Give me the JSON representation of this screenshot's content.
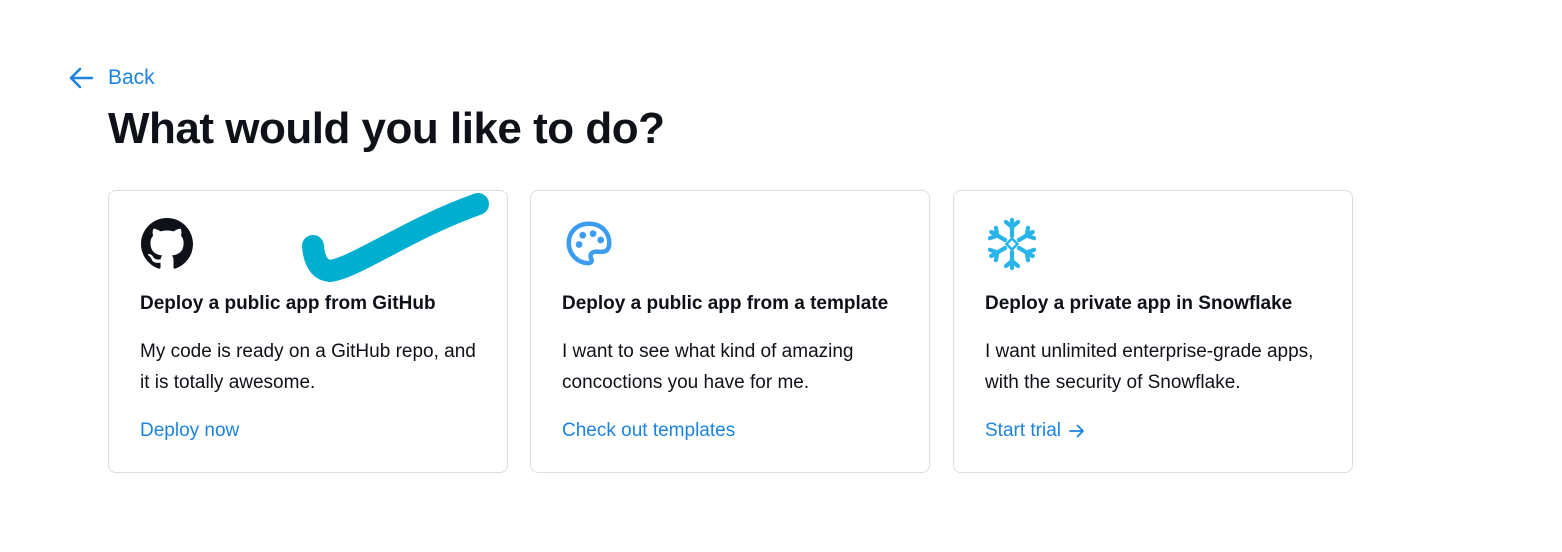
{
  "header": {
    "back_label": "Back",
    "title": "What would you like to do?"
  },
  "cards": [
    {
      "icon": "github-icon",
      "title": "Deploy a public app from GitHub",
      "description": "My code is ready on a GitHub repo, and it is totally awesome.",
      "link_label": "Deploy now"
    },
    {
      "icon": "palette-icon",
      "title": "Deploy a public app from a template",
      "description": "I want to see what kind of amazing concoctions you have for me.",
      "link_label": "Check out templates"
    },
    {
      "icon": "snowflake-icon",
      "title": "Deploy a private app in Snowflake",
      "description": "I want unlimited enterprise-grade apps, with the security of Snowflake.",
      "link_label": "Start trial",
      "link_icon": "arrow-right-icon"
    }
  ],
  "annotation": {
    "icon": "checkmark-icon",
    "color": "#00aecf"
  },
  "colors": {
    "accent": "#1c83e1",
    "palette_icon": "#3b9df0",
    "snowflake_icon": "#29b5e8",
    "card_border": "#dcdde1"
  }
}
